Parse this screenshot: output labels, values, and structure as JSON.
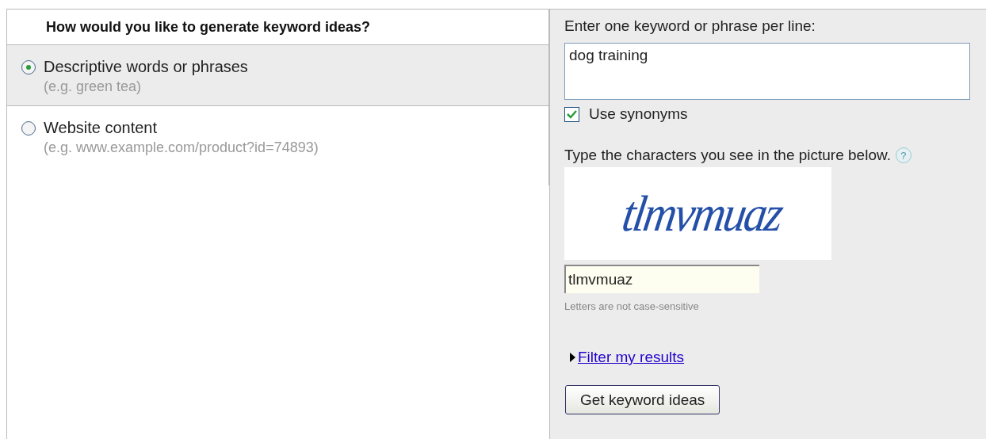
{
  "question": {
    "title": "How would you like to generate keyword ideas?"
  },
  "options": [
    {
      "label": "Descriptive words or phrases",
      "hint": "(e.g. green tea)",
      "selected": true
    },
    {
      "label": "Website content",
      "hint": "(e.g. www.example.com/product?id=74893)",
      "selected": false
    }
  ],
  "keywords": {
    "label": "Enter one keyword or phrase per line:",
    "value": "dog training"
  },
  "synonyms": {
    "label": "Use synonyms",
    "checked": true
  },
  "captcha": {
    "prompt": "Type the characters you see in the picture below.",
    "help": "?",
    "image_text": "tlmvmuaz",
    "value": "tlmvmuaz",
    "note": "Letters are not case-sensitive"
  },
  "filter_link": {
    "label": "Filter my results",
    "expanded": false
  },
  "submit": {
    "label": "Get keyword ideas"
  }
}
